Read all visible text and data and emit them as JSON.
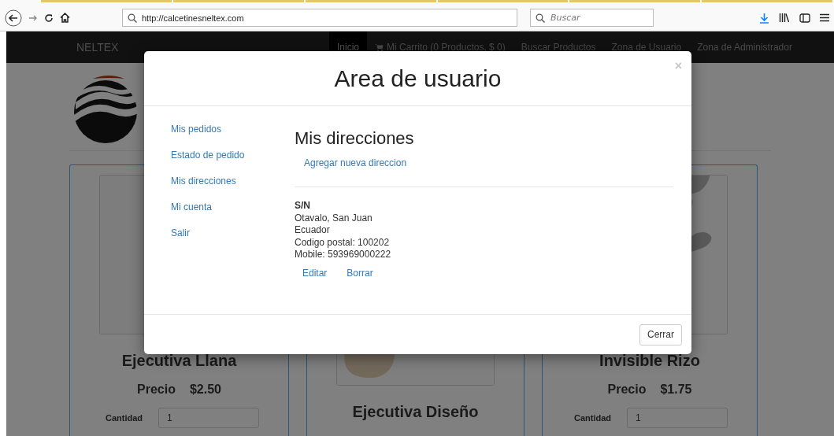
{
  "browser": {
    "url": "http://calcetinesneltex.com",
    "search": {
      "placeholder": "Buscar"
    }
  },
  "navbar": {
    "brand": "NELTEX",
    "items": [
      {
        "label": "Inicio",
        "selected": true,
        "kind": "link"
      },
      {
        "label": "Mi Carrito (0 Productos, $ 0)",
        "selected": false,
        "kind": "cart"
      },
      {
        "label": "Buscar Productos",
        "selected": false,
        "kind": "link"
      },
      {
        "label": "Zona de Usuario",
        "selected": false,
        "kind": "link"
      },
      {
        "label": "Zona de Administrador",
        "selected": false,
        "kind": "link"
      }
    ]
  },
  "products": [
    {
      "name": "Ejecutiva Llana",
      "price_label": "Precio",
      "price": "$2.50",
      "quantity_label": "Cantidad",
      "quantity": "1"
    },
    {
      "name": "Ejecutiva Diseño"
    },
    {
      "name": "Invisible Rizo",
      "price_label": "Precio",
      "price": "$1.75",
      "quantity_label": "Cantidad",
      "quantity": "1"
    }
  ],
  "modal": {
    "title": "Area de usuario",
    "close": "×",
    "menu": [
      {
        "label": "Mis pedidos"
      },
      {
        "label": "Estado de pedido"
      },
      {
        "label": "Mis direcciones"
      },
      {
        "label": "Mi cuenta"
      },
      {
        "label": "Salir"
      }
    ],
    "section_title": "Mis direcciones",
    "add_link": "Agregar nueva direccion",
    "address": {
      "name": "S/N",
      "lines": [
        "Otavalo, San Juan",
        "Ecuador",
        "Codigo postal: 100202",
        "Mobile: 593969000222"
      ]
    },
    "actions": [
      "Editar",
      "Borrar"
    ],
    "footer_button": "Cerrar"
  }
}
